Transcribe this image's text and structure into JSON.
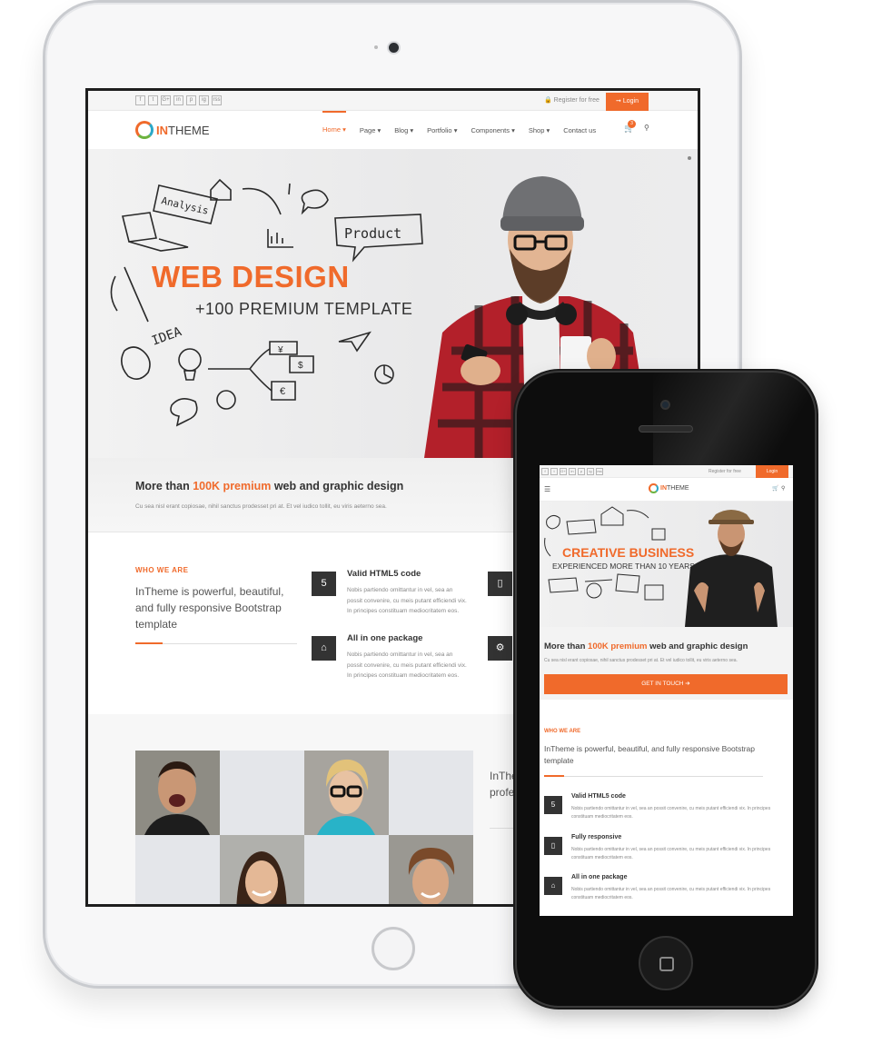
{
  "colors": {
    "accent": "#f06a2b",
    "dark": "#333333",
    "muted": "#888888"
  },
  "social_icons": [
    "f",
    "t",
    "G+",
    "in",
    "p",
    "ig",
    "rss"
  ],
  "tablet": {
    "topbar": {
      "register": "Register for free",
      "login": "Login"
    },
    "logo": {
      "part1": "IN",
      "part2": "THEME"
    },
    "menu": [
      "Home ▾",
      "Page ▾",
      "Blog ▾",
      "Portfolio ▾",
      "Components ▾",
      "Shop ▾",
      "Contact us"
    ],
    "cart_count": "3",
    "hero": {
      "title": "WEB DESIGN",
      "subtitle": "+100 PREMIUM TEMPLATE",
      "sketch_labels": [
        "Analysis",
        "Product",
        "IDEA"
      ]
    },
    "promo": {
      "title_pre": "More than ",
      "title_hl": "100K premium",
      "title_post": " web and graphic design",
      "text": "Cu sea nisl erant copiosae, nihil sanctus prodesset pri at. Et vel iudico tollit, eu viris aeterno sea."
    },
    "who": {
      "label": "WHO WE ARE",
      "text": "InTheme is powerful, beautiful, and fully responsive Bootstrap template"
    },
    "features": [
      {
        "icon": "5",
        "title": "Valid HTML5 code",
        "lines": [
          "Nobis partiendo omittantur in vel, sea an",
          "possit convenire, cu meis putant efficiendi vix.",
          "In principes constituam mediocritatem eos."
        ]
      },
      {
        "icon": "⌂",
        "title": "All in one package",
        "lines": [
          "Nobis partiendo omittantur in vel, sea an",
          "possit convenire, cu meis putant efficiendi vix.",
          "In principes constituam mediocritatem eos."
        ]
      }
    ],
    "team_side_text": [
      "InThe",
      "profe"
    ]
  },
  "phone": {
    "topbar": {
      "register": "Register for free",
      "login": "Login"
    },
    "logo": {
      "part1": "IN",
      "part2": "THEME"
    },
    "hero": {
      "title": "CREATIVE BUSINESS",
      "subtitle": "EXPERIENCED MORE THAN 10 YEARS"
    },
    "promo": {
      "title_pre": "More than ",
      "title_hl": "100K premium",
      "title_post": " web and graphic design",
      "text": "Cu sea nisl erant copiosae, nihil sanctus prodesset pri at. Et vel iudico tollit, eu viris aeterno sea.",
      "cta": "GET IN TOUCH ➔"
    },
    "who": {
      "label": "WHO WE ARE",
      "text": "InTheme is powerful, beautiful, and fully responsive Bootstrap template"
    },
    "features": [
      {
        "icon": "5",
        "title": "Valid HTML5 code",
        "text": "Nobis partiendo omittantur in vel, sea an possit convenire, cu meis putant efficiendi vix. In principes constituam mediocritatem eos."
      },
      {
        "icon": "▯",
        "title": "Fully responsive",
        "text": "Nobis partiendo omittantur in vel, sea an possit convenire, cu meis putant efficiendi vix. In principes constituam mediocritatem eos."
      },
      {
        "icon": "⌂",
        "title": "All in one package",
        "text": "Nobis partiendo omittantur in vel, sea an possit convenire, cu meis putant efficiendi vix. In principes constituam mediocritatem eos."
      }
    ]
  }
}
